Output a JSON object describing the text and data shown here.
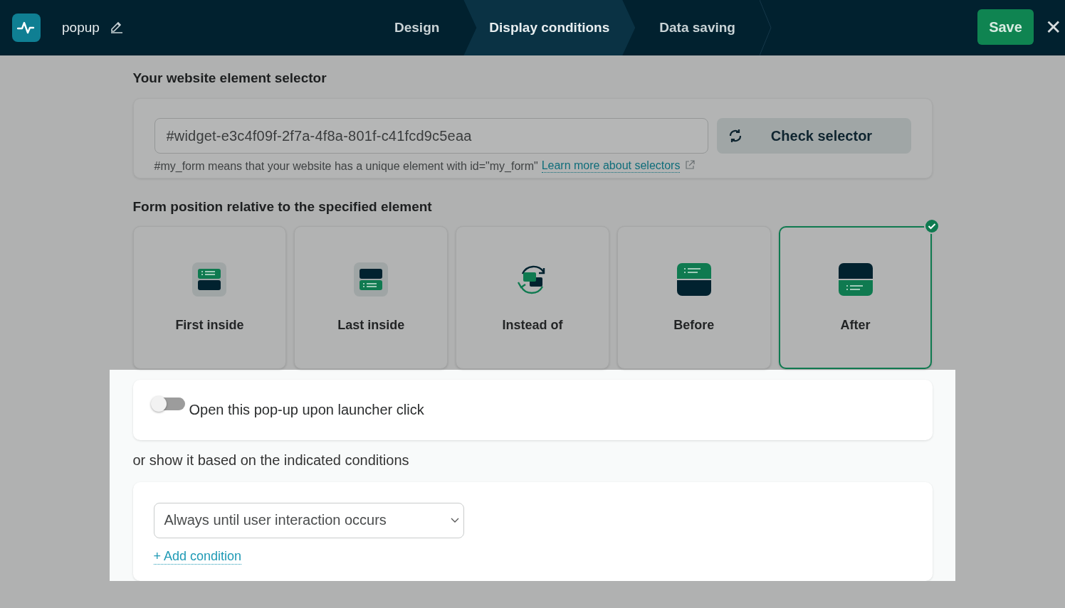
{
  "header": {
    "title": "popup",
    "save": "Save",
    "close": "✕",
    "steps": [
      {
        "label": "Design",
        "selected": false
      },
      {
        "label": "Display conditions",
        "selected": true
      },
      {
        "label": "Data saving",
        "selected": false
      }
    ]
  },
  "selector": {
    "heading": "Your website element selector",
    "value": "#widget-e3c4f09f-2f7a-4f8a-801f-c41fcd9c5eaa",
    "button": "Check selector",
    "hint": "#my_form means that your website has a unique element with id=\"my_form\"",
    "link": "Learn more about selectors"
  },
  "position": {
    "heading": "Form position relative to the specified element",
    "options": [
      {
        "label": "First inside",
        "kind": "first-inside",
        "selected": false
      },
      {
        "label": "Last inside",
        "kind": "last-inside",
        "selected": false
      },
      {
        "label": "Instead of",
        "kind": "instead-of",
        "selected": false
      },
      {
        "label": "Before",
        "kind": "before",
        "selected": false
      },
      {
        "label": "After",
        "kind": "after",
        "selected": true
      }
    ]
  },
  "launcher": {
    "label": "Open this pop-up upon launcher click",
    "on": false
  },
  "conditions": {
    "heading": "or show it based on the indicated conditions",
    "select": "Always until user interaction occurs",
    "add": "+ Add condition"
  }
}
